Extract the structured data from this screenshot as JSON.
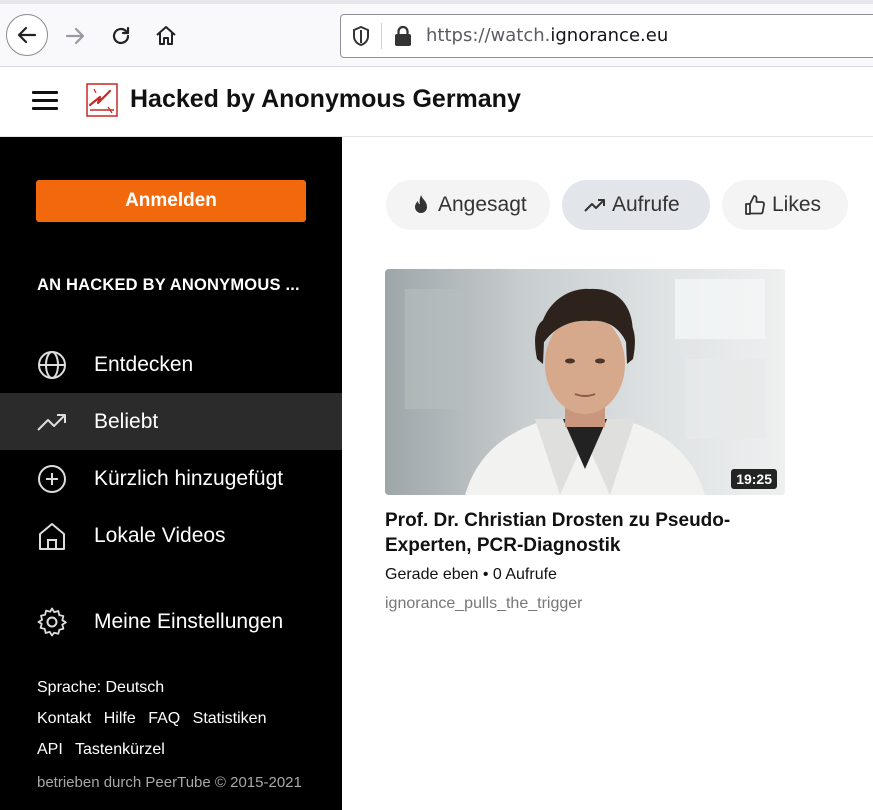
{
  "browser": {
    "url_prefix": "https://watch.",
    "url_host": "ignorance.eu"
  },
  "header": {
    "title": "Hacked by Anonymous Germany"
  },
  "sidebar": {
    "login_label": "Anmelden",
    "instance_name": "AN HACKED BY ANONYMOUS ...",
    "items": [
      {
        "label": "Entdecken",
        "icon": "globe-icon",
        "active": false
      },
      {
        "label": "Beliebt",
        "icon": "trending-icon",
        "active": true
      },
      {
        "label": "Kürzlich hinzugefügt",
        "icon": "plus-circle-icon",
        "active": false
      },
      {
        "label": "Lokale Videos",
        "icon": "home-icon",
        "active": false
      },
      {
        "label": "Meine Einstellungen",
        "icon": "gear-icon",
        "active": false
      }
    ],
    "language": "Sprache: Deutsch",
    "links_row1": [
      "Kontakt",
      "Hilfe",
      "FAQ",
      "Statistiken"
    ],
    "links_row2": [
      "API",
      "Tastenkürzel"
    ],
    "powered_by": "betrieben durch PeerTube © 2015-2021"
  },
  "filters": [
    {
      "label": "Angesagt",
      "icon": "flame-icon",
      "active": false
    },
    {
      "label": "Aufrufe",
      "icon": "trending-icon",
      "active": true
    },
    {
      "label": "Likes",
      "icon": "thumbs-up-icon",
      "active": false
    }
  ],
  "video": {
    "duration": "19:25",
    "title": "Prof. Dr. Christian Drosten zu Pseudo-Experten, PCR-Diagnostik",
    "meta": "Gerade eben • 0 Aufrufe",
    "channel": "ignorance_pulls_the_trigger"
  },
  "colors": {
    "accent": "#f1680d",
    "sidebar_bg": "#000000",
    "active_item_bg": "#2b2b2b"
  }
}
